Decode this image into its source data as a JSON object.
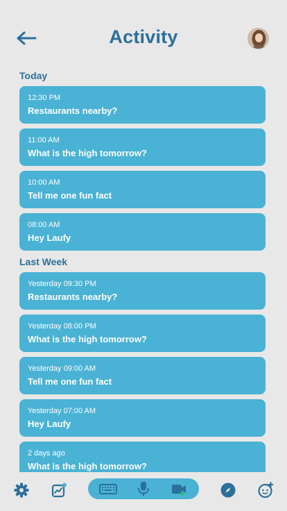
{
  "header": {
    "title": "Activity"
  },
  "sections": [
    {
      "label": "Today",
      "items": [
        {
          "time": "12:30 PM",
          "query": "Restaurants nearby?"
        },
        {
          "time": "11:00 AM",
          "query": "What is the high tomorrow?"
        },
        {
          "time": "10:00 AM",
          "query": "Tell me one fun fact"
        },
        {
          "time": "08:00 AM",
          "query": "Hey Laufy"
        }
      ]
    },
    {
      "label": "Last Week",
      "items": [
        {
          "time": "Yesterday 09:30 PM",
          "query": "Restaurants nearby?"
        },
        {
          "time": "Yesterday 08:00 PM",
          "query": "What is the high tomorrow?"
        },
        {
          "time": "Yesterday 09:00 AM",
          "query": "Tell me one fun fact"
        },
        {
          "time": "Yesterday 07:00 AM",
          "query": "Hey Laufy"
        },
        {
          "time": "2 days ago",
          "query": "What is the high tomorrow?"
        }
      ]
    }
  ],
  "bottom_bar": {
    "icons": [
      "gear-icon",
      "chart-icon",
      "keyboard-icon",
      "microphone-icon",
      "video-camera-icon",
      "compass-icon",
      "face-plus-icon"
    ]
  },
  "colors": {
    "background": "#e8e8e8",
    "accent": "#2b6f9b",
    "card": "#4ab2d4",
    "status_dot": "#22c55e"
  }
}
